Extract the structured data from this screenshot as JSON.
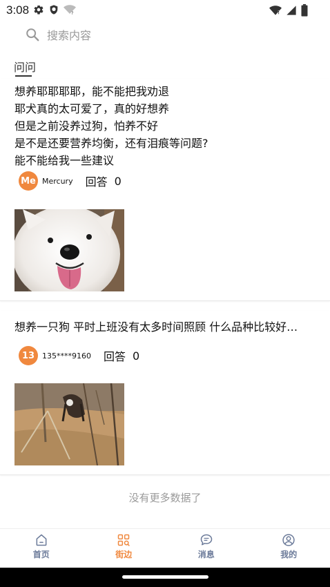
{
  "status_bar": {
    "time": "3:08",
    "icons_left": [
      "gear-icon",
      "shield-icon",
      "wifi-question-icon"
    ],
    "icons_right": [
      "wifi-icon",
      "signal-icon",
      "battery-icon"
    ]
  },
  "search": {
    "placeholder": "搜索内容"
  },
  "tab": {
    "label": "问问"
  },
  "posts": [
    {
      "text": "想养耶耶耶耶，能不能把我劝退\n耶犬真的太可爱了，真的好想养\n但是之前没养过狗，怕养不好\n是不是还要营养均衡，还有泪痕等问题?\n能不能给我一些建议",
      "avatar_text": "Me",
      "username": "Mercury",
      "answer_label": "回答",
      "answer_count": "0",
      "image": "white-samoyed-dog-photo"
    },
    {
      "text": "想养一只狗 平时上班没有太多时间照顾 什么品种比较好…",
      "avatar_text": "13",
      "username": "135****9160",
      "answer_label": "回答",
      "answer_count": "0",
      "image": "dog-in-woods-photo"
    }
  ],
  "footer": {
    "no_more": "没有更多数据了"
  },
  "bottom_nav": [
    {
      "label": "首页",
      "icon": "home-icon",
      "active": false
    },
    {
      "label": "街边",
      "icon": "grid-search-icon",
      "active": true
    },
    {
      "label": "消息",
      "icon": "chat-bubble-icon",
      "active": false
    },
    {
      "label": "我的",
      "icon": "user-circle-icon",
      "active": false
    }
  ],
  "colors": {
    "accent": "#f0883e",
    "nav_inactive": "#6b7a99",
    "muted_text": "#9a9a9a"
  }
}
